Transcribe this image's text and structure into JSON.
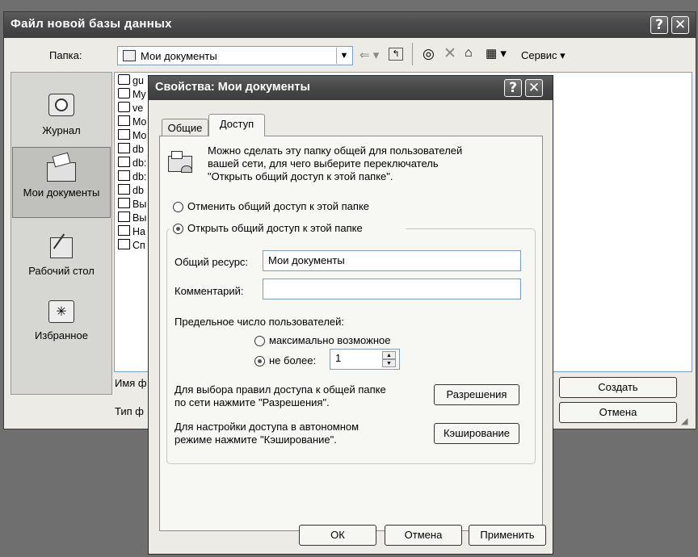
{
  "main_window": {
    "title": "Файл новой базы данных",
    "help_btn": "?",
    "close_btn": "✕",
    "folder_label": "Папка:",
    "folder_value": "Мои документы",
    "service_label": "Сервис",
    "places": [
      {
        "label": "Журнал",
        "icon": "history-icon"
      },
      {
        "label": "Мои документы",
        "icon": "my-documents-icon"
      },
      {
        "label": "Рабочий стол",
        "icon": "desktop-icon"
      },
      {
        "label": "Избранное",
        "icon": "favorites-icon"
      }
    ],
    "files": [
      "gu",
      "My",
      "ve",
      "Mo",
      "Mo",
      "db",
      "db:",
      "db:",
      "db",
      "Вы",
      "Вы",
      "На",
      "Сп"
    ],
    "filename_label": "Имя ф",
    "filetype_label": "Тип ф",
    "create_btn": "Создать",
    "cancel_btn": "Отмена"
  },
  "dialog": {
    "title": "Свойства: Мои документы",
    "help_btn": "?",
    "close_btn": "✕",
    "tabs": [
      "Общие",
      "Доступ"
    ],
    "active_tab": "Доступ",
    "intro_text_1": "Можно сделать эту папку общей для пользователей",
    "intro_text_2": "вашей сети, для чего выберите переключатель",
    "intro_text_3": "\"Открыть общий доступ к этой папке\".",
    "radio_no_share": "Отменить общий доступ к этой папке",
    "radio_share": "Открыть общий доступ к этой папке",
    "share_name_label": "Общий ресурс:",
    "share_name_value": "Мои документы",
    "comment_label": "Комментарий:",
    "comment_value": "",
    "user_limit_label": "Предельное число пользователей:",
    "radio_max": "максимально возможное",
    "radio_not_more": "не более:",
    "user_limit_value": "1",
    "permissions_text_1": "Для выбора правил доступа к общей папке",
    "permissions_text_2": "по сети нажмите \"Разрешения\".",
    "permissions_btn": "Разрешения",
    "caching_text_1": "Для настройки доступа в автономном",
    "caching_text_2": "режиме нажмите \"Кэширование\".",
    "caching_btn": "Кэширование",
    "ok_btn": "ОК",
    "cancel_btn": "Отмена",
    "apply_btn": "Применить"
  }
}
